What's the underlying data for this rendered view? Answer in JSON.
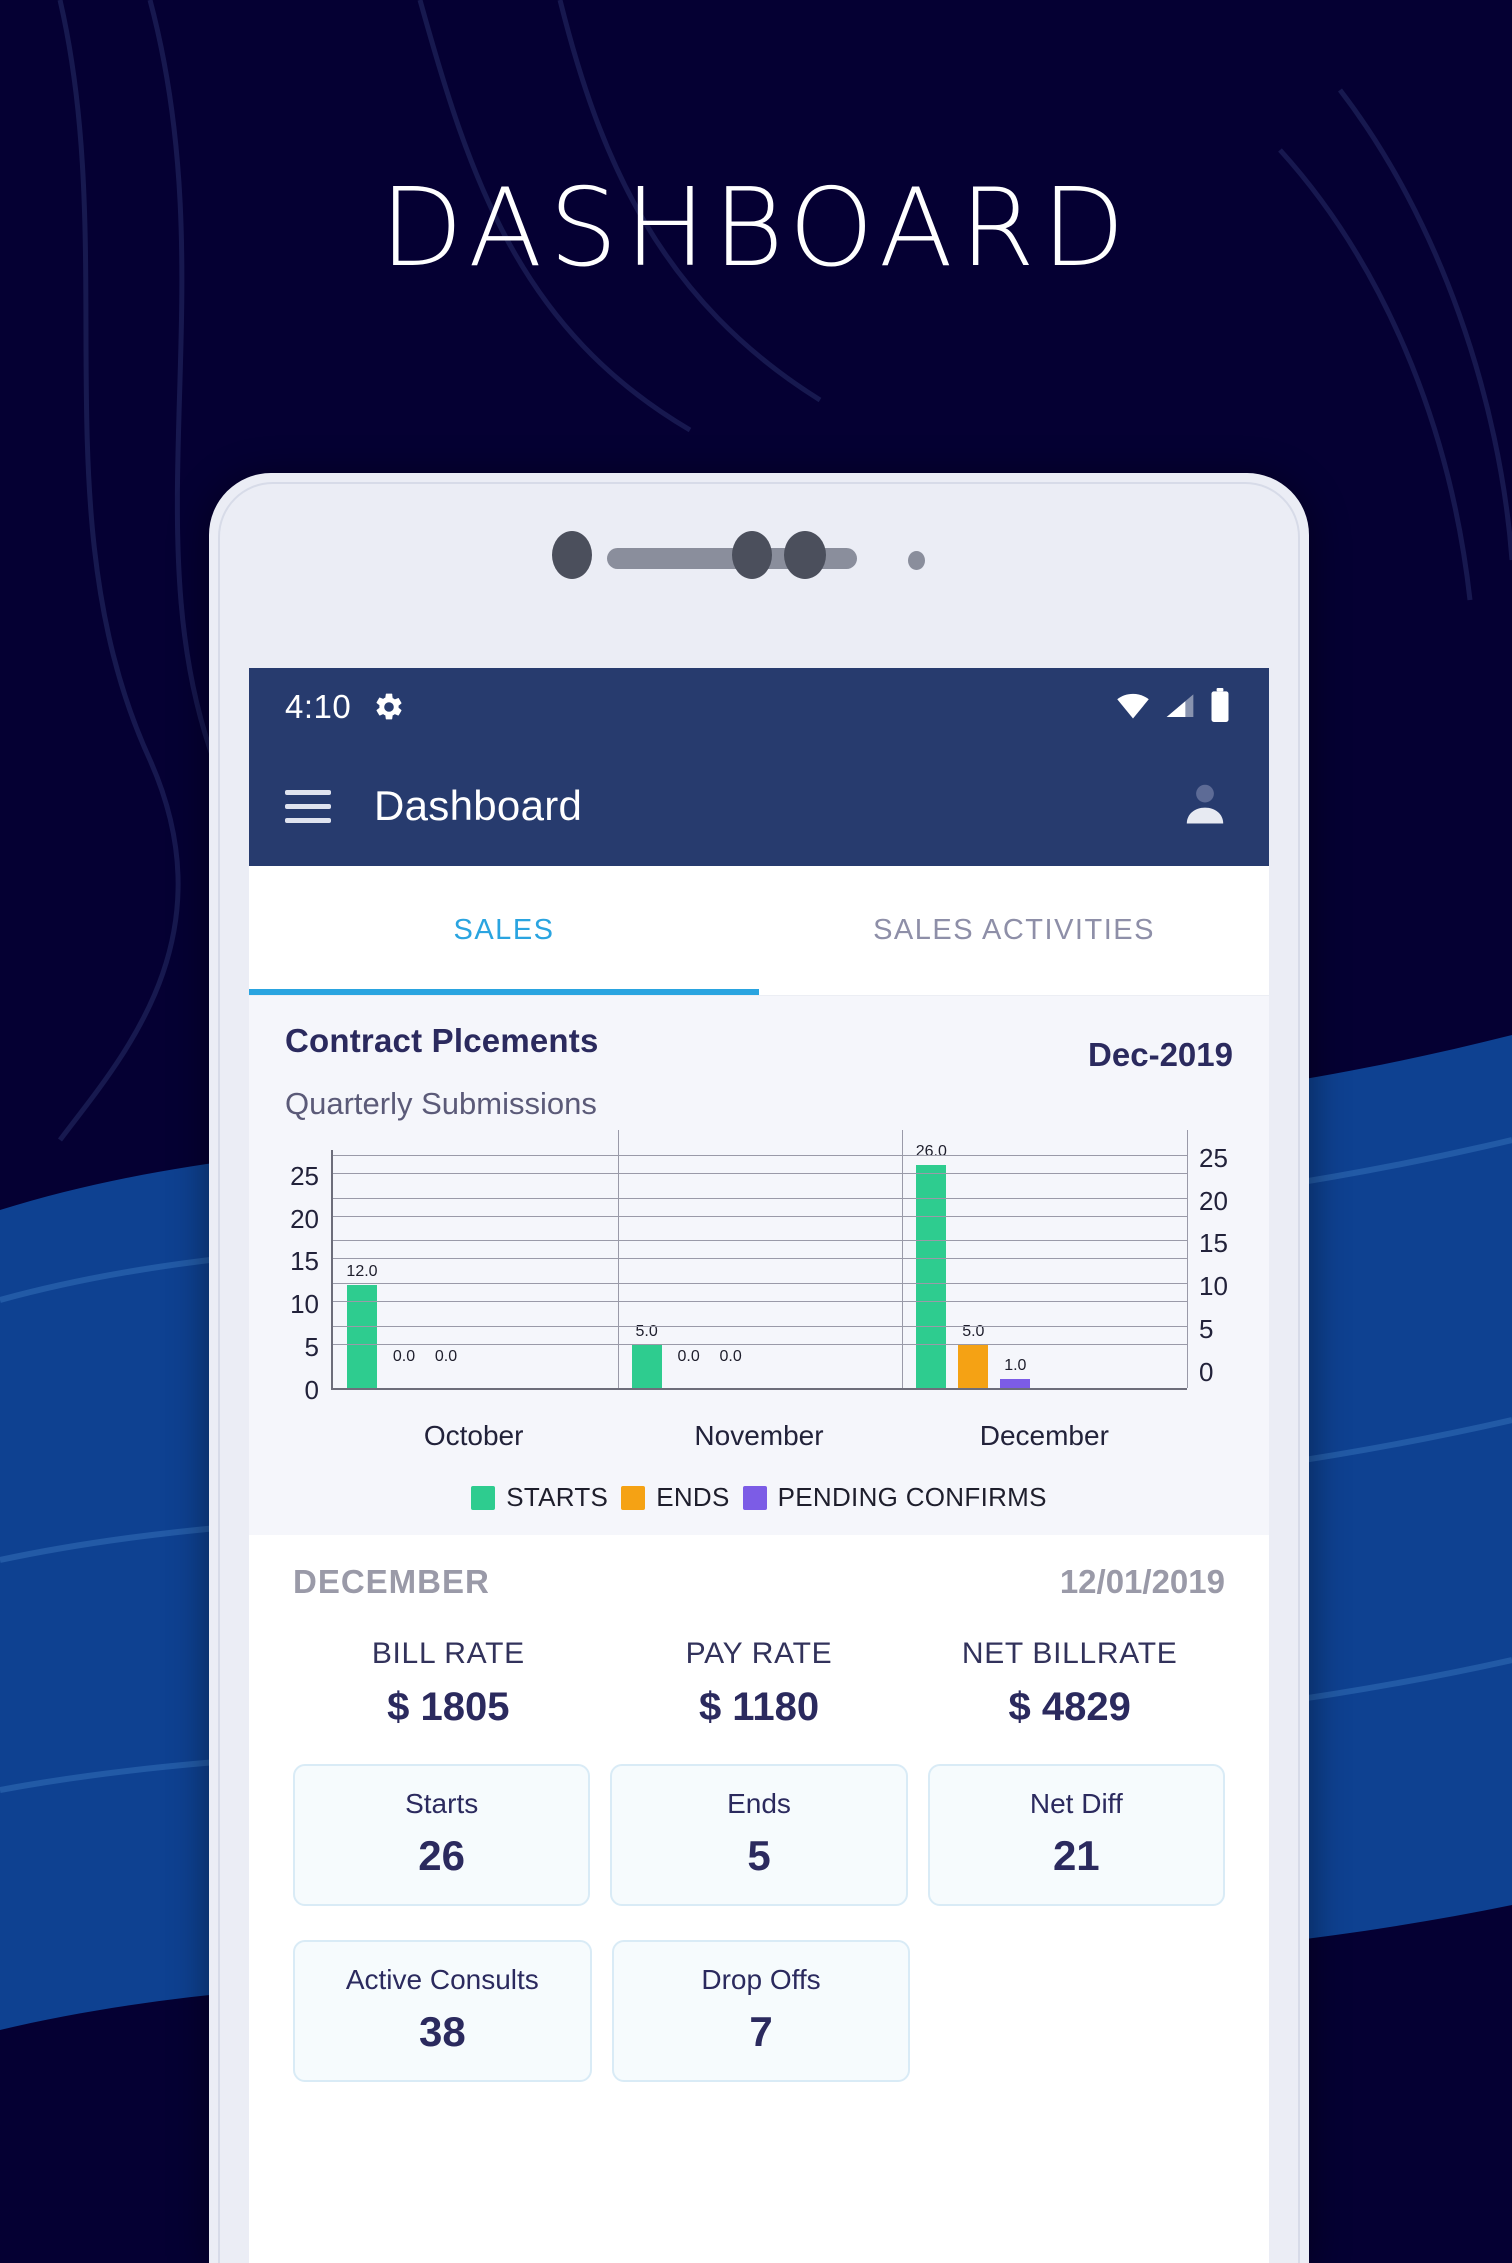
{
  "hero": {
    "title": "DASHBOARD"
  },
  "colors": {
    "bg_dark": "#050033",
    "bg_blue": "#0e4191",
    "navy": "#273b6e",
    "accent_blue": "#2aa4e0",
    "green": "#2ecc8f",
    "orange": "#f5a214",
    "purple": "#7c5ce6",
    "text_navy": "#2b2a5e",
    "muted": "#9a9aa8"
  },
  "status_bar": {
    "time": "4:10",
    "gear_icon": "gear-icon",
    "wifi_icon": "wifi-icon",
    "signal_icon": "cellular-signal-icon",
    "battery_icon": "battery-icon"
  },
  "app_bar": {
    "menu_icon": "hamburger-menu-icon",
    "title": "Dashboard",
    "account_icon": "account-avatar-icon"
  },
  "tabs": [
    {
      "label": "SALES",
      "active": true
    },
    {
      "label": "SALES ACTIVITIES",
      "active": false
    }
  ],
  "chart_card": {
    "title": "Contract Plcements",
    "period": "Dec-2019",
    "subtitle": "Quarterly Submissions"
  },
  "chart_data": {
    "type": "bar",
    "title": "Contract Plcements",
    "subtitle": "Quarterly Submissions",
    "xlabel": "",
    "ylabel": "",
    "categories": [
      "October",
      "November",
      "December"
    ],
    "series": [
      {
        "name": "STARTS",
        "color": "#2ecc8f",
        "values": [
          12.0,
          5.0,
          26.0
        ]
      },
      {
        "name": "ENDS",
        "color": "#f5a214",
        "values": [
          0.0,
          0.0,
          5.0
        ]
      },
      {
        "name": "PENDING CONFIRMS",
        "color": "#7c5ce6",
        "values": [
          0.0,
          0.0,
          1.0
        ]
      }
    ],
    "data_labels": [
      [
        "12.0",
        "0.0",
        "0.0"
      ],
      [
        "5.0",
        "0.0",
        "0.0"
      ],
      [
        "26.0",
        "5.0",
        "1.0"
      ]
    ],
    "y_ticks_left": [
      0,
      5,
      10,
      15,
      20,
      25
    ],
    "y_ticks_right": [
      0,
      5,
      10,
      15,
      20,
      25
    ],
    "ylim": [
      0,
      28
    ],
    "grid": true,
    "legend_position": "bottom",
    "legend": [
      "STARTS",
      "ENDS",
      "PENDING CONFIRMS"
    ]
  },
  "stats": {
    "month": "DECEMBER",
    "date": "12/01/2019",
    "rates": [
      {
        "label": "BILL RATE",
        "value": "$ 1805"
      },
      {
        "label": "PAY RATE",
        "value": "$ 1180"
      },
      {
        "label": "NET BILLRATE",
        "value": "$ 4829"
      }
    ],
    "tiles_row1": [
      {
        "label": "Starts",
        "value": "26"
      },
      {
        "label": "Ends",
        "value": "5"
      },
      {
        "label": "Net Diff",
        "value": "21"
      }
    ],
    "tiles_row2": [
      {
        "label": "Active Consults",
        "value": "38"
      },
      {
        "label": "Drop Offs",
        "value": "7"
      }
    ]
  }
}
